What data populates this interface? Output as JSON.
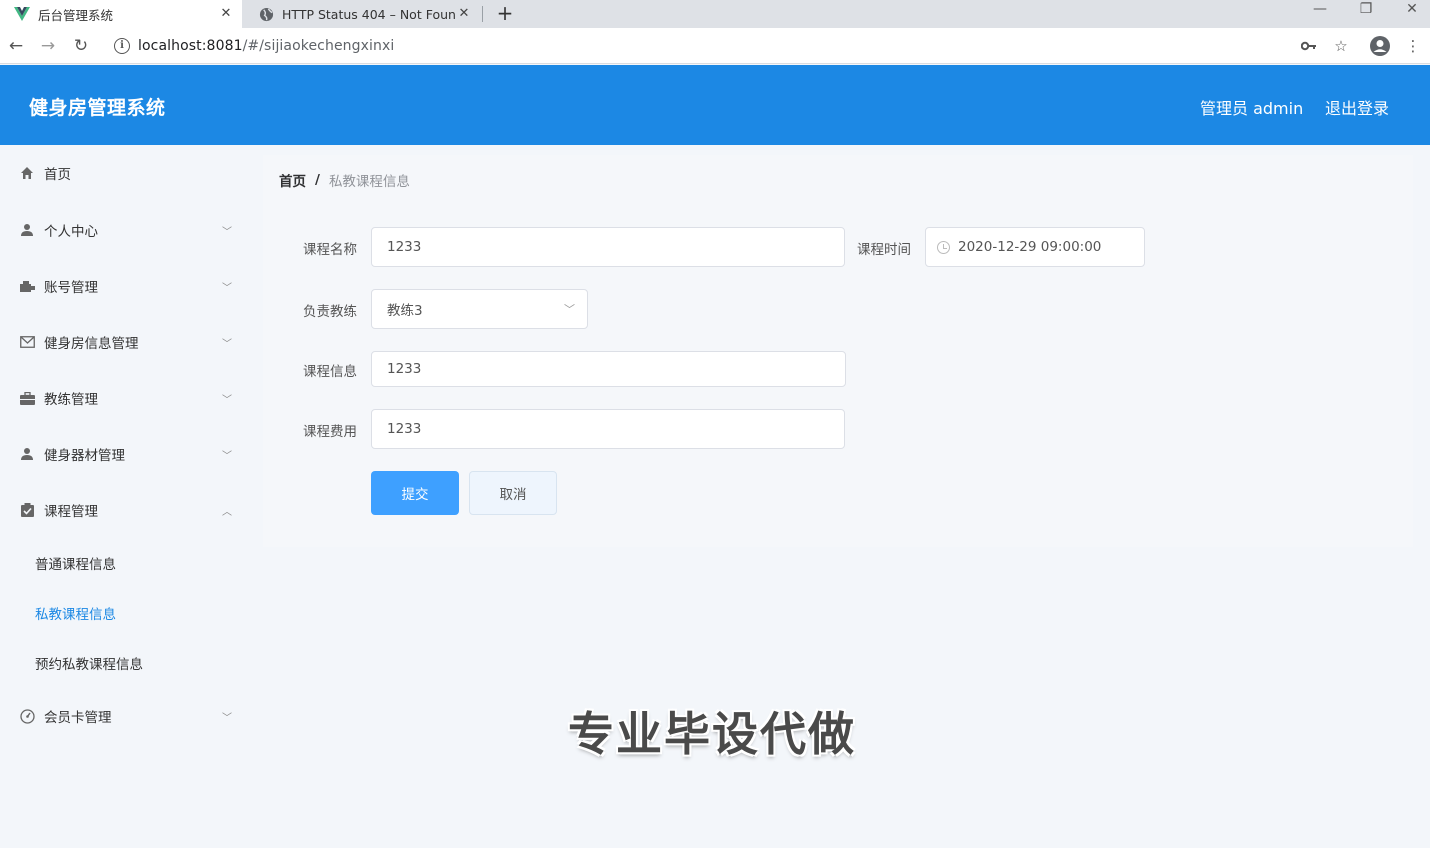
{
  "browser": {
    "tabs": [
      {
        "title": "后台管理系统",
        "active": true,
        "icon": "vue-logo-icon"
      },
      {
        "title": "HTTP Status 404 – Not Found",
        "active": false,
        "icon": "globe-icon"
      }
    ],
    "url_host": "localhost:8081",
    "url_path": "/#/sijiaokechengxinxi"
  },
  "header": {
    "title": "健身房管理系统",
    "user": "管理员 admin",
    "logout": "退出登录",
    "color": "#1c88e4"
  },
  "sidebar": {
    "items": [
      {
        "label": "首页",
        "icon": "home-icon"
      },
      {
        "label": "个人中心",
        "icon": "user-icon"
      },
      {
        "label": "账号管理",
        "icon": "account-icon"
      },
      {
        "label": "健身房信息管理",
        "icon": "mail-icon"
      },
      {
        "label": "教练管理",
        "icon": "briefcase-icon"
      },
      {
        "label": "健身器材管理",
        "icon": "user-icon"
      },
      {
        "label": "课程管理",
        "icon": "clipboard-icon"
      },
      {
        "label": "会员卡管理",
        "icon": "speedometer-icon"
      }
    ],
    "sub_items": [
      {
        "label": "普通课程信息",
        "active": false
      },
      {
        "label": "私教课程信息",
        "active": true
      },
      {
        "label": "预约私教课程信息",
        "active": false
      }
    ]
  },
  "breadcrumb": {
    "home": "首页",
    "separator": "/",
    "current": "私教课程信息"
  },
  "form": {
    "course_name_label": "课程名称",
    "course_name_value": "1233",
    "course_time_label": "课程时间",
    "course_time_value": "2020-12-29 09:00:00",
    "coach_label": "负责教练",
    "coach_value": "教练3",
    "course_info_label": "课程信息",
    "course_info_value": "1233",
    "course_fee_label": "课程费用",
    "course_fee_value": "1233",
    "submit_label": "提交",
    "cancel_label": "取消"
  },
  "watermark": "专业毕设代做"
}
